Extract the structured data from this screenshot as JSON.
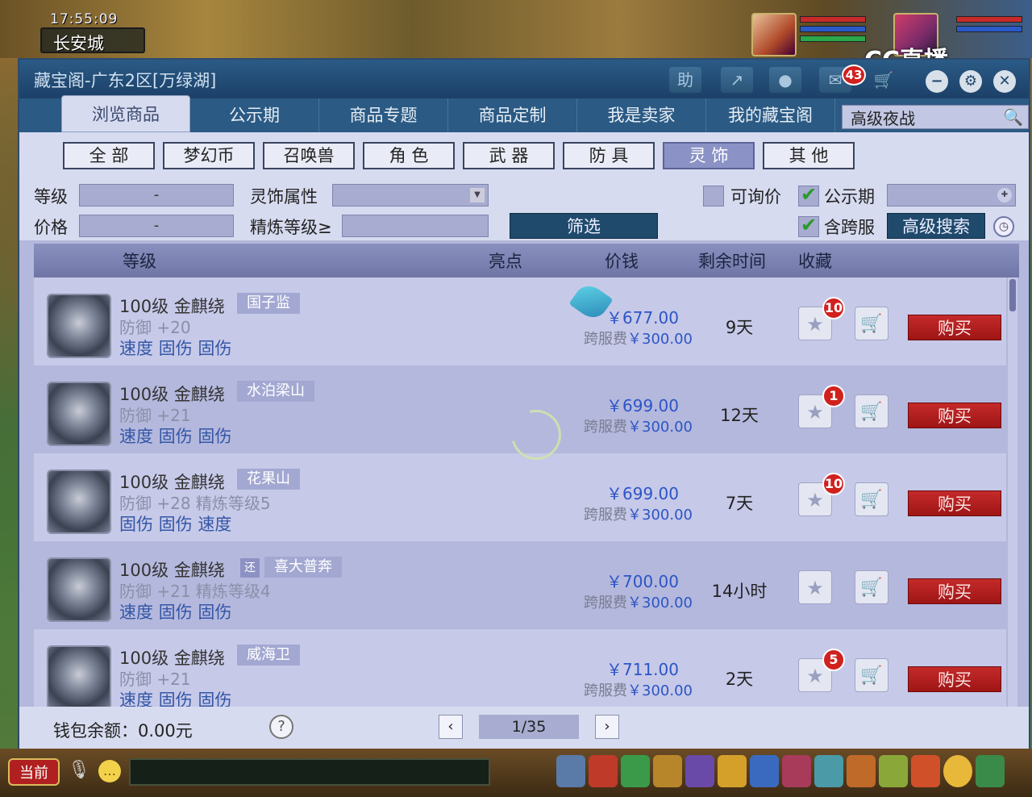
{
  "hud": {
    "clock": "17:55:09",
    "city": "长安城",
    "overlay_logo": "CC直播"
  },
  "window": {
    "title": "藏宝阁-广东2区[万绿湖]",
    "help_button": "助",
    "message_count": "43"
  },
  "tabs": [
    "浏览商品",
    "公示期",
    "商品专题",
    "商品定制",
    "我是卖家",
    "我的藏宝阁"
  ],
  "search": {
    "value": "高级夜战"
  },
  "categories": [
    "全 部",
    "梦幻币",
    "召唤兽",
    "角 色",
    "武 器",
    "防 具",
    "灵 饰",
    "其 他"
  ],
  "active_category": "灵 饰",
  "filters": {
    "level_label": "等级",
    "price_label": "价格",
    "range_sep": "-",
    "attr_label": "灵饰属性",
    "refine_label": "精炼等级≥",
    "filter_button": "筛选",
    "inquiry_label": "可询价",
    "publicity_label": "公示期",
    "cross_server_label": "含跨服",
    "advanced_search": "高级搜索"
  },
  "columns": {
    "level": "等级",
    "highlight": "亮点",
    "price": "价钱",
    "remaining": "剩余时间",
    "favorite": "收藏"
  },
  "items": [
    {
      "name": "100级 金麒绕",
      "server": "国子监",
      "huan": "",
      "line2": "防御 +20",
      "line3": "速度 固伤 固伤",
      "price": "￥677.00",
      "fee_label": "跨服费",
      "fee": "￥300.00",
      "time": "9天",
      "favs": "10",
      "buy": "购买"
    },
    {
      "name": "100级 金麒绕",
      "server": "水泊梁山",
      "huan": "",
      "line2": "防御 +21",
      "line3": "速度 固伤 固伤",
      "price": "￥699.00",
      "fee_label": "跨服费",
      "fee": "￥300.00",
      "time": "12天",
      "favs": "1",
      "buy": "购买"
    },
    {
      "name": "100级 金麒绕",
      "server": "花果山",
      "huan": "",
      "line2": "防御 +28 精炼等级5",
      "line3": "固伤 固伤 速度",
      "price": "￥699.00",
      "fee_label": "跨服费",
      "fee": "￥300.00",
      "time": "7天",
      "favs": "10",
      "buy": "购买"
    },
    {
      "name": "100级 金麒绕",
      "server": "喜大普奔",
      "huan": "还",
      "line2": "防御 +21 精炼等级4",
      "line3": "速度 固伤 固伤",
      "price": "￥700.00",
      "fee_label": "跨服费",
      "fee": "￥300.00",
      "time": "14小时",
      "favs": "",
      "buy": "购买"
    },
    {
      "name": "100级 金麒绕",
      "server": "威海卫",
      "huan": "",
      "line2": "防御 +21",
      "line3": "速度 固伤 固伤",
      "price": "￥711.00",
      "fee_label": "跨服费",
      "fee": "￥300.00",
      "time": "2天",
      "favs": "5",
      "buy": "购买"
    }
  ],
  "footer": {
    "wallet": "钱包余额：0.00元",
    "help": "?",
    "page": "1/35"
  },
  "bottom": {
    "current_channel": "当前"
  }
}
